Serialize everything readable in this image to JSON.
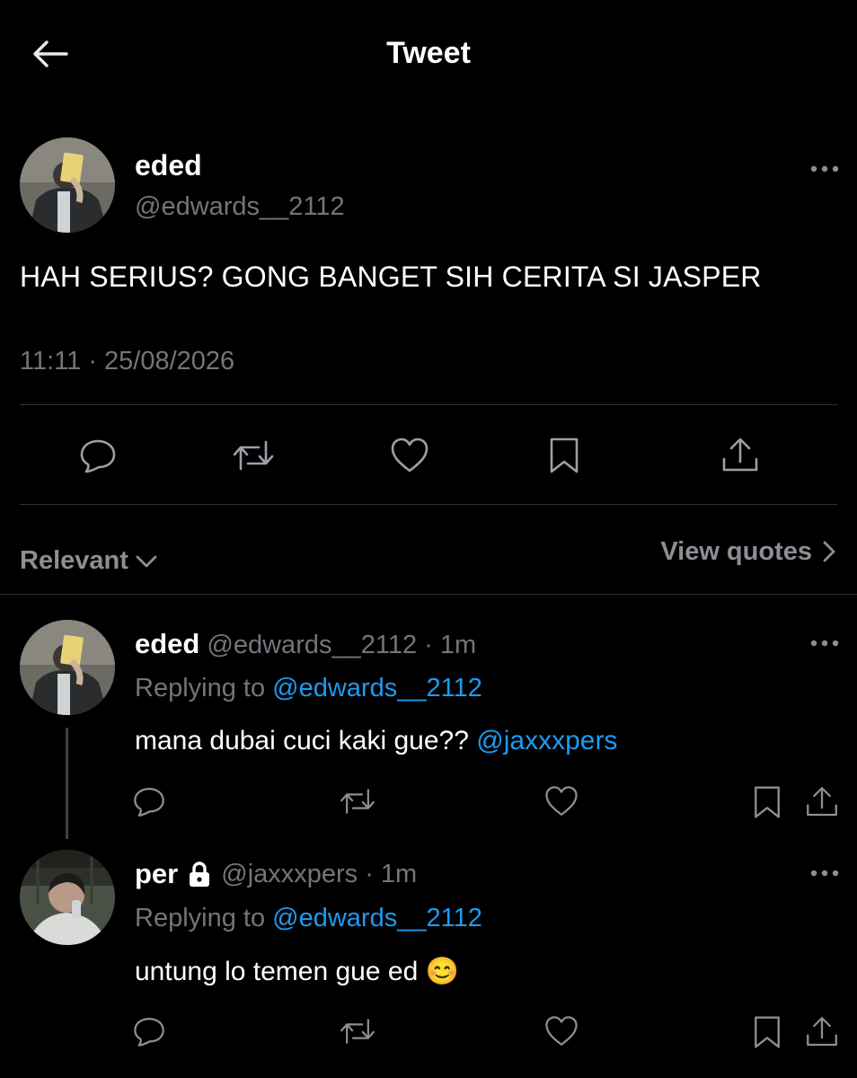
{
  "header": {
    "title": "Tweet"
  },
  "main_tweet": {
    "display_name": "eded",
    "handle": "@edwards__2112",
    "text": "HAH SERIUS? GONG BANGET SIH CERITA SI JASPER",
    "timestamp": "11:11 · 25/08/2026"
  },
  "sort": {
    "label": "Relevant",
    "view_quotes": "View quotes"
  },
  "replies": [
    {
      "display_name": "eded",
      "handle": "@edwards__2112",
      "time": "· 1m",
      "replying_prefix": "Replying to",
      "replying_to": "@edwards__2112",
      "text": "mana dubai cuci kaki gue??",
      "mention": "@jaxxxpers"
    },
    {
      "display_name": "per",
      "handle": "@jaxxxpers",
      "time": "· 1m",
      "replying_prefix": "Replying to",
      "replying_to": "@edwards__2112",
      "text": "untung lo temen gue ed",
      "emoji": "😊"
    }
  ],
  "colors": {
    "background": "#000000",
    "text": "#e7e9ea",
    "muted": "#71767b",
    "link": "#1d9bf0",
    "divider": "#2f3336"
  }
}
